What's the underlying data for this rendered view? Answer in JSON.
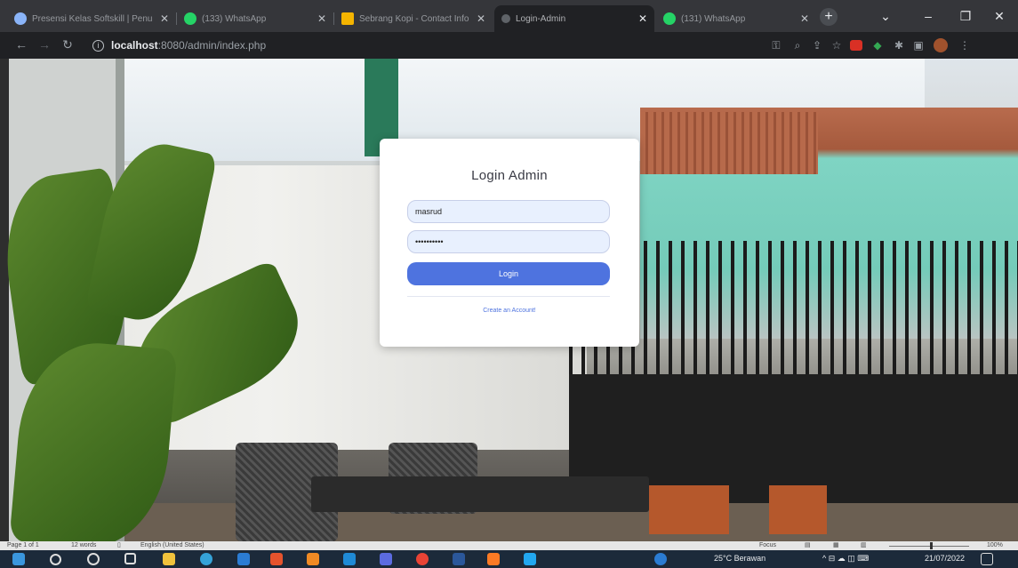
{
  "browser": {
    "tabs": [
      {
        "title": "Presensi Kelas Softskill | Penu",
        "icon_color": "#8ab4f8",
        "active": false
      },
      {
        "title": "(133) WhatsApp",
        "icon_color": "#25d366",
        "active": false
      },
      {
        "title": "Sebrang Kopi - Contact Info",
        "icon_color": "#f4b400",
        "active": false
      },
      {
        "title": "Login-Admin",
        "icon_color": "#5f6368",
        "active": true
      },
      {
        "title": "(131) WhatsApp",
        "icon_color": "#25d366",
        "active": false
      }
    ],
    "new_tab_label": "+",
    "window_controls": {
      "chevron": "⌄",
      "minimize": "–",
      "maximize": "❐",
      "close": "✕"
    },
    "address": {
      "host": "localhost",
      "path": ":8080/admin/index.php"
    }
  },
  "login": {
    "title": "Login Admin",
    "username_value": "masrud",
    "password_value": "••••••••••",
    "login_button": "Login",
    "create_account": "Create an Account!"
  },
  "word_status": {
    "page": "Page 1 of 1",
    "words": "12 words",
    "language": "English (United States)",
    "focus": "Focus",
    "zoom": "100%",
    "zoom_level": 0.5
  },
  "taskbar": {
    "weather": "25°C  Berawan",
    "date": "21/07/2022"
  }
}
